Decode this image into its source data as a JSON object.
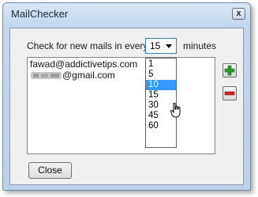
{
  "window": {
    "title": "MailChecker",
    "close_glyph": "x"
  },
  "settings": {
    "check_label": "Check for new mails in every",
    "interval_value": "15",
    "minutes_label": "minutes"
  },
  "interval_dropdown": {
    "options": [
      "1",
      "5",
      "10",
      "15",
      "30",
      "45",
      "60"
    ],
    "highlighted": "10"
  },
  "accounts": {
    "items": [
      "fawad@addictivetips.com",
      "@gmail.com"
    ],
    "redacted_prefix_for_item_1": true
  },
  "buttons": {
    "add": "add-account",
    "remove": "remove-account",
    "close_label": "Close"
  },
  "colors": {
    "selection": "#3399ff",
    "add_icon": "#2f9e2f",
    "remove_icon": "#cc2222"
  }
}
